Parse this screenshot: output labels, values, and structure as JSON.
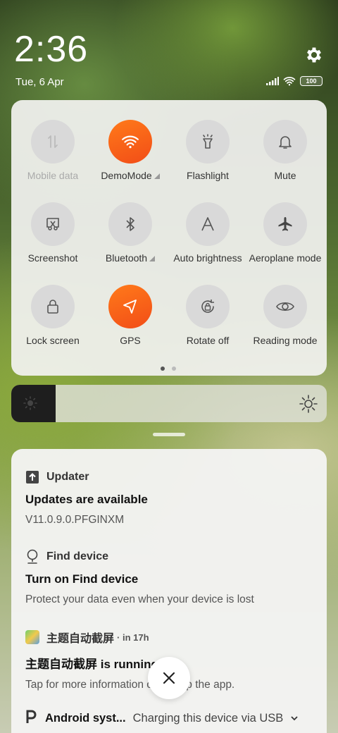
{
  "status": {
    "time": "2:36",
    "date": "Tue, 6 Apr",
    "battery": "100"
  },
  "quick_settings": {
    "tiles": [
      {
        "label": "Mobile data",
        "icon": "mobile-data-icon",
        "active": false,
        "disabled": true
      },
      {
        "label": "DemoMode",
        "icon": "wifi-icon",
        "active": true,
        "expand": true
      },
      {
        "label": "Flashlight",
        "icon": "flashlight-icon",
        "active": false
      },
      {
        "label": "Mute",
        "icon": "bell-icon",
        "active": false
      },
      {
        "label": "Screenshot",
        "icon": "screenshot-icon",
        "active": false
      },
      {
        "label": "Bluetooth",
        "icon": "bluetooth-icon",
        "active": false,
        "expand": true
      },
      {
        "label": "Auto brightness",
        "icon": "auto-brightness-icon",
        "active": false
      },
      {
        "label": "Aeroplane mode",
        "icon": "airplane-icon",
        "active": false
      },
      {
        "label": "Lock screen",
        "icon": "lock-icon",
        "active": false
      },
      {
        "label": "GPS",
        "icon": "gps-icon",
        "active": true
      },
      {
        "label": "Rotate off",
        "icon": "rotate-lock-icon",
        "active": false
      },
      {
        "label": "Reading mode",
        "icon": "eye-icon",
        "active": false
      }
    ],
    "page_indicator": {
      "pages": 2,
      "current": 1
    }
  },
  "brightness": {
    "level": 0.14
  },
  "notifications": {
    "updater": {
      "app": "Updater",
      "title": "Updates are available",
      "text": "V11.0.9.0.PFGINXM"
    },
    "find_device": {
      "app": "Find device",
      "title": "Turn on Find device",
      "text": "Protect your data even when your device is lost"
    },
    "theme": {
      "app": "主题自动截屏",
      "time": "· in 17h",
      "title": "主题自动截屏 is running",
      "text": "Tap for more information or to stop the app."
    },
    "android": {
      "app": "Android syst...",
      "text": "Charging this device via USB"
    }
  },
  "colors": {
    "accent": "#f7611a"
  }
}
